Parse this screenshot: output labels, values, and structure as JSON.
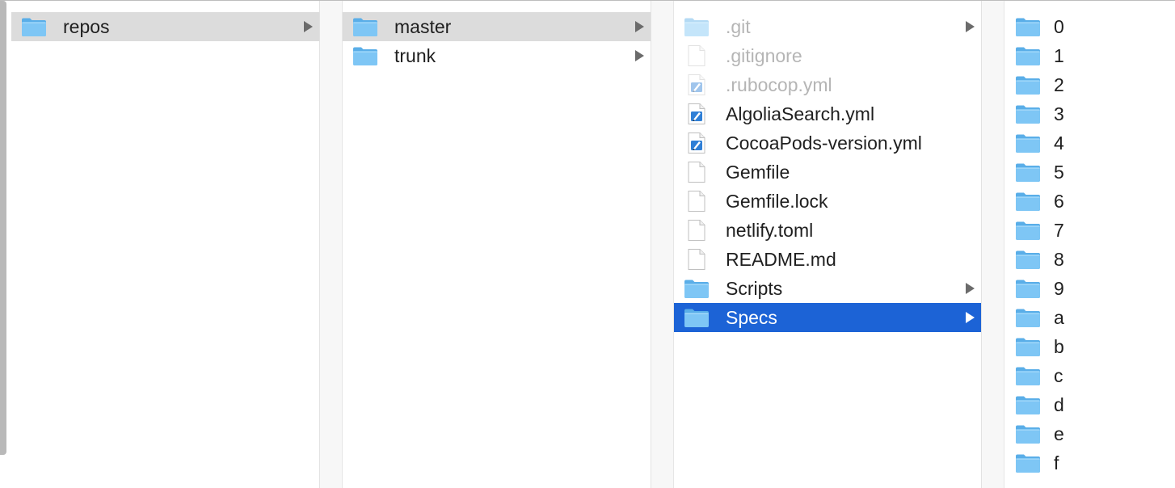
{
  "columns": [
    {
      "items": [
        {
          "label": "repos",
          "type": "folder",
          "has_children": true,
          "state": "inactive-selected"
        }
      ]
    },
    {
      "items": [
        {
          "label": "master",
          "type": "folder",
          "has_children": true,
          "state": "inactive-selected"
        },
        {
          "label": "trunk",
          "type": "folder",
          "has_children": true,
          "state": "normal"
        }
      ]
    },
    {
      "items": [
        {
          "label": ".git",
          "type": "folder",
          "has_children": true,
          "state": "hidden"
        },
        {
          "label": ".gitignore",
          "type": "file",
          "has_children": false,
          "state": "hidden"
        },
        {
          "label": ".rubocop.yml",
          "type": "yml",
          "has_children": false,
          "state": "hidden"
        },
        {
          "label": "AlgoliaSearch.yml",
          "type": "yml",
          "has_children": false,
          "state": "normal"
        },
        {
          "label": "CocoaPods-version.yml",
          "type": "yml",
          "has_children": false,
          "state": "normal"
        },
        {
          "label": "Gemfile",
          "type": "file",
          "has_children": false,
          "state": "normal"
        },
        {
          "label": "Gemfile.lock",
          "type": "file",
          "has_children": false,
          "state": "normal"
        },
        {
          "label": "netlify.toml",
          "type": "file",
          "has_children": false,
          "state": "normal"
        },
        {
          "label": "README.md",
          "type": "file",
          "has_children": false,
          "state": "normal"
        },
        {
          "label": "Scripts",
          "type": "folder",
          "has_children": true,
          "state": "normal"
        },
        {
          "label": "Specs",
          "type": "folder",
          "has_children": true,
          "state": "active-selected"
        }
      ]
    },
    {
      "items": [
        {
          "label": "0",
          "type": "folder"
        },
        {
          "label": "1",
          "type": "folder"
        },
        {
          "label": "2",
          "type": "folder"
        },
        {
          "label": "3",
          "type": "folder"
        },
        {
          "label": "4",
          "type": "folder"
        },
        {
          "label": "5",
          "type": "folder"
        },
        {
          "label": "6",
          "type": "folder"
        },
        {
          "label": "7",
          "type": "folder"
        },
        {
          "label": "8",
          "type": "folder"
        },
        {
          "label": "9",
          "type": "folder"
        },
        {
          "label": "a",
          "type": "folder"
        },
        {
          "label": "b",
          "type": "folder"
        },
        {
          "label": "c",
          "type": "folder"
        },
        {
          "label": "d",
          "type": "folder"
        },
        {
          "label": "e",
          "type": "folder"
        },
        {
          "label": "f",
          "type": "folder"
        }
      ]
    }
  ],
  "colors": {
    "selection_active": "#1c63d6",
    "selection_inactive": "#dcdcdc",
    "folder_blue": "#6fbcf2",
    "hidden_text": "#b5b5b5"
  }
}
